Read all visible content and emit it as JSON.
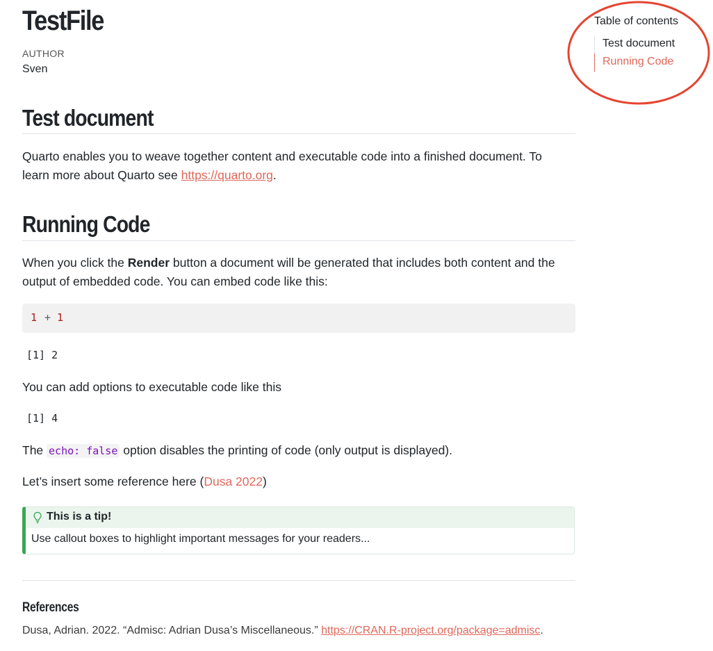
{
  "doc": {
    "title": "TestFile",
    "author_label": "AUTHOR",
    "author_name": "Sven"
  },
  "sections": {
    "test_document": {
      "heading": "Test document",
      "para_prefix": "Quarto enables you to weave together content and executable code into a finished document. To learn more about Quarto see ",
      "link_text": "https://quarto.org",
      "para_suffix": "."
    },
    "running_code": {
      "heading": "Running Code",
      "para1_prefix": "When you click the ",
      "para1_bold": "Render",
      "para1_suffix": " button a document will be generated that includes both content and the output of embedded code. You can embed code like this:",
      "code_lhs": "1",
      "code_op": "+",
      "code_rhs": "1",
      "output1": "[1] 2",
      "para2": "You can add options to executable code like this",
      "output2": "[1] 4",
      "para3_prefix": "The ",
      "para3_code": "echo: false",
      "para3_suffix": " option disables the printing of code (only output is displayed).",
      "para4_prefix": "Let’s insert some reference here (",
      "para4_cite": "Dusa 2022",
      "para4_suffix": ")"
    }
  },
  "callout": {
    "icon": "lightbulb-icon",
    "title": "This is a tip!",
    "body": "Use callout boxes to highlight important messages for your readers...",
    "accent_color": "#3aa655"
  },
  "references": {
    "title": "References",
    "entry_text": "Dusa, Adrian. 2022. “Admisc: Adrian Dusa’s Miscellaneous.” ",
    "entry_link": "https://CRAN.R-project.org/package=admisc",
    "entry_suffix": "."
  },
  "toc": {
    "title": "Table of contents",
    "items": [
      {
        "label": "Test document",
        "active": false
      },
      {
        "label": "Running Code",
        "active": true
      }
    ]
  },
  "colors": {
    "link": "#e0675a",
    "annotation_circle": "#e5452f"
  }
}
